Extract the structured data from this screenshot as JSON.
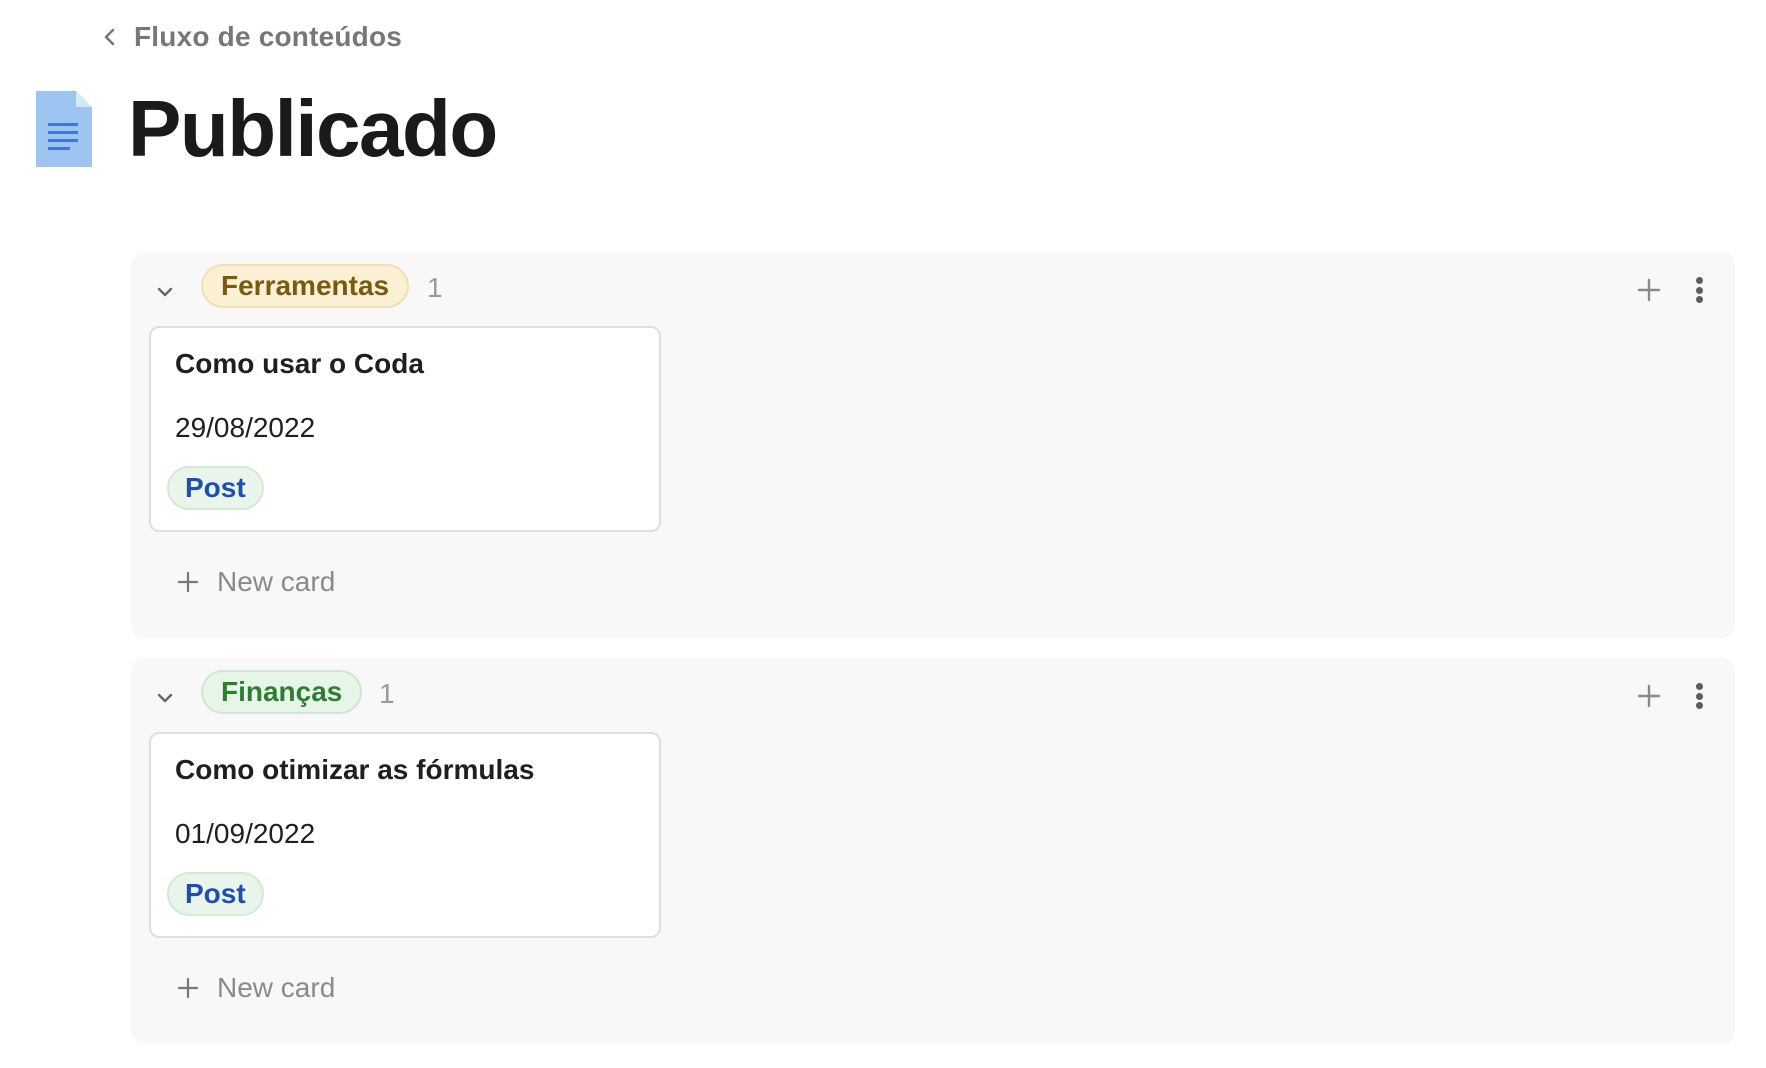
{
  "breadcrumb": {
    "label": "Fluxo de conteúdos"
  },
  "page": {
    "title": "Publicado",
    "icon": "document-icon"
  },
  "groups": [
    {
      "tag": "Ferramentas",
      "tag_color": "#7a5a12",
      "tag_bg": "#fbf0d4",
      "count": "1",
      "cards": [
        {
          "title": "Como usar o Coda",
          "date": "29/08/2022",
          "type": "Post"
        }
      ],
      "new_card_label": "New card"
    },
    {
      "tag": "Finanças",
      "tag_color": "#2e7d32",
      "tag_bg": "#e7f4e8",
      "count": "1",
      "cards": [
        {
          "title": "Como otimizar as fórmulas",
          "date": "01/09/2022",
          "type": "Post"
        }
      ],
      "new_card_label": "New card"
    }
  ]
}
